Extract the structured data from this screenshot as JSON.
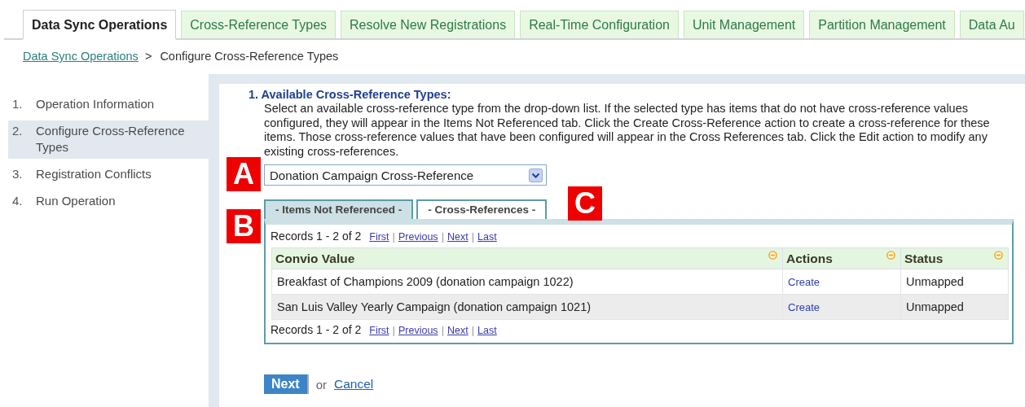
{
  "top_tabs": [
    {
      "label": "Data Sync Operations",
      "selected": true
    },
    {
      "label": "Cross-Reference Types",
      "selected": false
    },
    {
      "label": "Resolve New Registrations",
      "selected": false
    },
    {
      "label": "Real-Time Configuration",
      "selected": false
    },
    {
      "label": "Unit Management",
      "selected": false
    },
    {
      "label": "Partition Management",
      "selected": false
    },
    {
      "label": "Data Au",
      "selected": false
    }
  ],
  "breadcrumb": {
    "link": "Data Sync Operations",
    "separator": ">",
    "current": "Configure Cross-Reference Types"
  },
  "steps": [
    {
      "number": "1.",
      "label": "Operation Information",
      "selected": false
    },
    {
      "number": "2.",
      "label": "Configure Cross-Reference Types",
      "selected": true
    },
    {
      "number": "3.",
      "label": "Registration Conflicts",
      "selected": false
    },
    {
      "number": "4.",
      "label": "Run Operation",
      "selected": false
    }
  ],
  "section": {
    "heading": "1. Available Cross-Reference Types:",
    "description": "Select an available cross-reference type from the drop-down list. If the selected type has items that do not have cross-reference values configured, they will appear in the Items Not Referenced tab. Click the Create Cross-Reference action to create a cross-reference for these items. Those cross-reference values that have been configured will appear in the Cross References tab. Click the Edit action to modify any existing cross-references.",
    "dropdown": {
      "value": "Donation Campaign Cross-Reference"
    }
  },
  "sub_tabs": [
    {
      "label": "- Items Not Referenced -",
      "selected": true
    },
    {
      "label": "- Cross-References -",
      "selected": false
    }
  ],
  "pager_top": {
    "summary": "Records 1 - 2 of 2",
    "links": [
      "First",
      "Previous",
      "Next",
      "Last"
    ],
    "separator": "|"
  },
  "table": {
    "columns": [
      "Convio Value",
      "Actions",
      "Status"
    ],
    "rows": [
      {
        "cells": [
          "Breakfast of Champions 2009 (donation campaign 1022)",
          "Create",
          "Unmapped"
        ]
      },
      {
        "cells": [
          "San Luis Valley Yearly Campaign (donation campaign 1021)",
          "Create",
          "Unmapped"
        ]
      }
    ]
  },
  "pager_bottom": {
    "summary": "Records 1 - 2 of 2",
    "links": [
      "First",
      "Previous",
      "Next",
      "Last"
    ],
    "separator": "|"
  },
  "callouts": [
    "A",
    "B",
    "C"
  ],
  "footer": {
    "button": "Next",
    "or": "or",
    "cancel": "Cancel"
  }
}
